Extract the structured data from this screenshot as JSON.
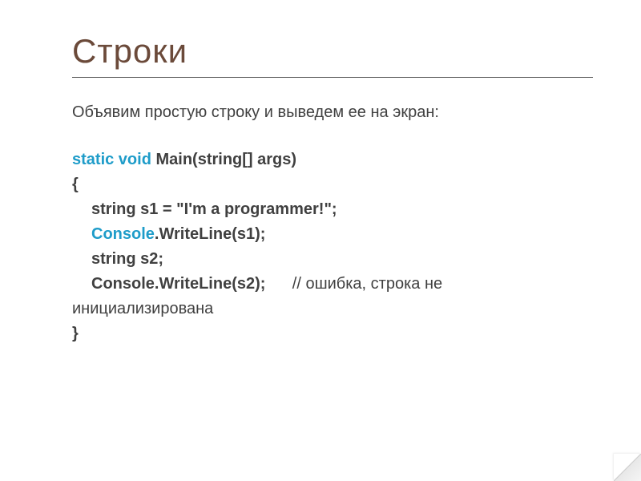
{
  "slide": {
    "title": "Строки",
    "intro": "Объявим простую строку и выведем ее на экран:",
    "code": {
      "l1_kw": "static void",
      "l1_rest": " Main(string[] args)",
      "brace_open": "{",
      "l2": "string s1 = \"I'm a programmer!\";",
      "l3_kw": "Console",
      "l3_rest": ".WriteLine(s1);",
      "l4": "string s2;",
      "l5_bold": "Console.WriteLine(s2);",
      "l5_comment": "      // ошибка, строка не",
      "l6": "инициализирована",
      "brace_close": "}"
    }
  }
}
